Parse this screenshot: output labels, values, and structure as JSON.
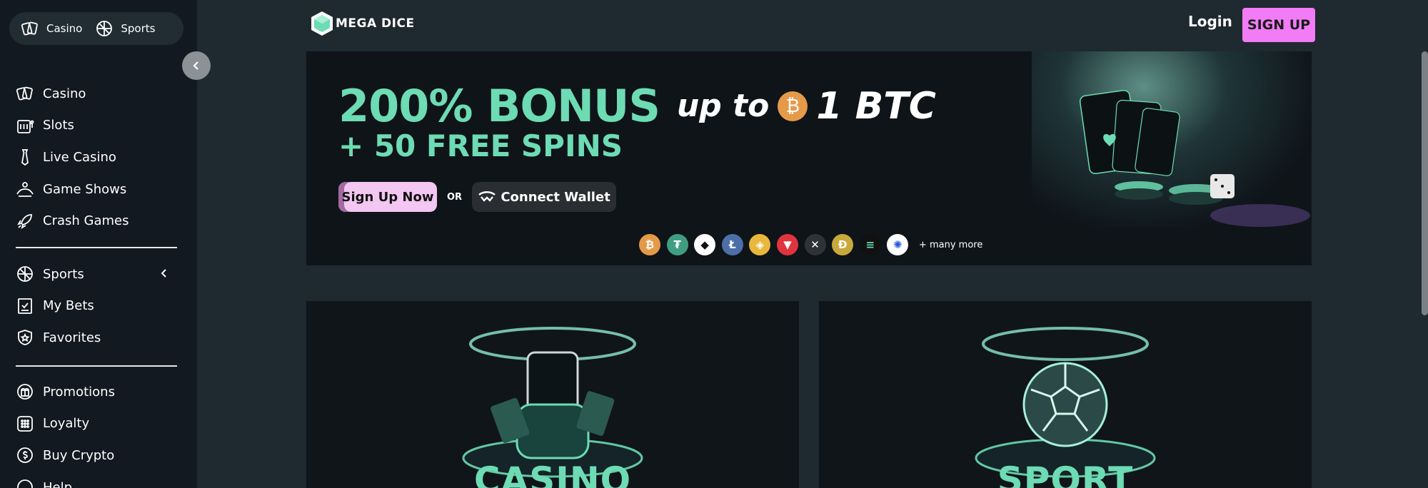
{
  "sidebar": {
    "mode_tabs": [
      {
        "label": "Casino",
        "icon": "cards-icon"
      },
      {
        "label": "Sports",
        "icon": "ball-icon"
      }
    ],
    "main_items": [
      {
        "label": "Casino",
        "icon": "cards-icon"
      },
      {
        "label": "Slots",
        "icon": "slot-machine-icon"
      },
      {
        "label": "Live Casino",
        "icon": "tie-icon"
      },
      {
        "label": "Game Shows",
        "icon": "crown-icon"
      },
      {
        "label": "Crash Games",
        "icon": "rocket-icon"
      }
    ],
    "sports_items": [
      {
        "label": "Sports",
        "icon": "ball-icon"
      },
      {
        "label": "My Bets",
        "icon": "bet-slip-icon"
      },
      {
        "label": "Favorites",
        "icon": "shield-star-icon"
      }
    ],
    "extra_items": [
      {
        "label": "Promotions",
        "icon": "gift-icon"
      },
      {
        "label": "Loyalty",
        "icon": "grid-icon"
      },
      {
        "label": "Buy Crypto",
        "icon": "dollar-coin-icon"
      },
      {
        "label": "Help",
        "icon": "help-icon"
      }
    ]
  },
  "header": {
    "logo_text": "MEGA DICE",
    "login_label": "Login",
    "signup_label": "SIGN UP"
  },
  "banner": {
    "headline": "200% BONUS",
    "upto": "up to",
    "amount": "1 BTC",
    "free_spins": "+ 50 FREE SPINS",
    "signup_now": "Sign Up Now",
    "or": "OR",
    "connect_wallet": "Connect Wallet",
    "many_more": "+ many more",
    "coins": [
      {
        "name": "bitcoin",
        "glyph": "₿",
        "color": "#e59a49"
      },
      {
        "name": "tether",
        "glyph": "₮",
        "color": "#3f9e82"
      },
      {
        "name": "ethereum",
        "glyph": "◆",
        "color": "#ffffff"
      },
      {
        "name": "litecoin",
        "glyph": "Ł",
        "color": "#4d6fa8"
      },
      {
        "name": "binance",
        "glyph": "◈",
        "color": "#e8b73c"
      },
      {
        "name": "tron",
        "glyph": "▼",
        "color": "#e0343f"
      },
      {
        "name": "xrp",
        "glyph": "✕",
        "color": "#2f3337"
      },
      {
        "name": "dogecoin",
        "glyph": "Ð",
        "color": "#c9a93a"
      },
      {
        "name": "solana",
        "glyph": "≡",
        "color": "#111111"
      },
      {
        "name": "cardano",
        "glyph": "✺",
        "color": "#ffffff"
      }
    ]
  },
  "cards": {
    "casino_title": "CASINO",
    "sport_title": "SPORT"
  },
  "colors": {
    "accent": "#6ddbb3",
    "signup": "#f27cf5",
    "sidebar_bg": "#121920",
    "page_bg": "#1e2930"
  }
}
